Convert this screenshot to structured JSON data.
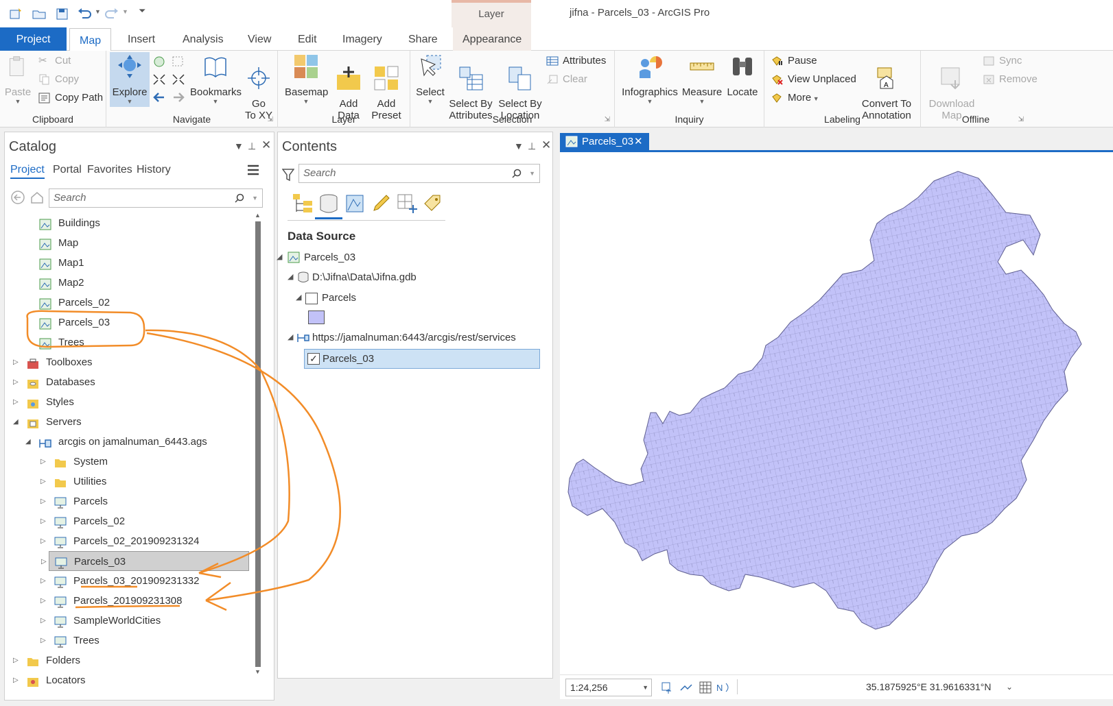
{
  "app": {
    "title": "jifna - Parcels_03 - ArcGIS Pro",
    "context_tab_group": "Layer"
  },
  "tabs": [
    "Project",
    "Map",
    "Insert",
    "Analysis",
    "View",
    "Edit",
    "Imagery",
    "Share",
    "Appearance"
  ],
  "active_tab": "Map",
  "ribbon": {
    "clipboard": {
      "label": "Clipboard",
      "paste": "Paste",
      "cut": "Cut",
      "copy": "Copy",
      "copy_path": "Copy Path"
    },
    "navigate": {
      "label": "Navigate",
      "explore": "Explore",
      "bookmarks": "Bookmarks",
      "goto": "Go\nTo XY"
    },
    "layer": {
      "label": "Layer",
      "basemap": "Basemap",
      "add_data": "Add\nData",
      "add_preset": "Add\nPreset"
    },
    "selection": {
      "label": "Selection",
      "select": "Select",
      "select_by_attributes": "Select By\nAttributes",
      "select_by_location": "Select By\nLocation",
      "attributes": "Attributes",
      "clear": "Clear"
    },
    "inquiry": {
      "label": "Inquiry",
      "infographics": "Infographics",
      "measure": "Measure",
      "locate": "Locate"
    },
    "labeling": {
      "label": "Labeling",
      "pause": "Pause",
      "view_unplaced": "View Unplaced",
      "more": "More",
      "convert": "Convert To\nAnnotation"
    },
    "offline": {
      "label": "Offline",
      "download": "Download\nMap",
      "sync": "Sync",
      "remove": "Remove"
    }
  },
  "catalog": {
    "title": "Catalog",
    "tabs": [
      "Project",
      "Portal",
      "Favorites",
      "History"
    ],
    "search_placeholder": "Search",
    "items": [
      {
        "label": "Buildings",
        "type": "map",
        "indent": 2,
        "expand": ""
      },
      {
        "label": "Map",
        "type": "map",
        "indent": 2,
        "expand": ""
      },
      {
        "label": "Map1",
        "type": "map",
        "indent": 2,
        "expand": ""
      },
      {
        "label": "Map2",
        "type": "map",
        "indent": 2,
        "expand": ""
      },
      {
        "label": "Parcels_02",
        "type": "map",
        "indent": 2,
        "expand": ""
      },
      {
        "label": "Parcels_03",
        "type": "map",
        "indent": 2,
        "expand": ""
      },
      {
        "label": "Trees",
        "type": "map",
        "indent": 2,
        "expand": ""
      },
      {
        "label": "Toolboxes",
        "type": "toolbox",
        "indent": 1,
        "expand": "collapsed"
      },
      {
        "label": "Databases",
        "type": "database",
        "indent": 1,
        "expand": "collapsed"
      },
      {
        "label": "Styles",
        "type": "style",
        "indent": 1,
        "expand": "collapsed"
      },
      {
        "label": "Servers",
        "type": "server",
        "indent": 1,
        "expand": "expanded"
      },
      {
        "label": "arcgis on jamalnuman_6443.ags",
        "type": "ags",
        "indent": 2,
        "expand": "expanded"
      },
      {
        "label": "System",
        "type": "folder",
        "indent": 3,
        "expand": "collapsed"
      },
      {
        "label": "Utilities",
        "type": "folder",
        "indent": 3,
        "expand": "collapsed"
      },
      {
        "label": "Parcels",
        "type": "service",
        "indent": 3,
        "expand": "collapsed"
      },
      {
        "label": "Parcels_02",
        "type": "service",
        "indent": 3,
        "expand": "collapsed"
      },
      {
        "label": "Parcels_02_201909231324",
        "type": "service",
        "indent": 3,
        "expand": "collapsed"
      },
      {
        "label": "Parcels_03",
        "type": "service",
        "indent": 3,
        "expand": "collapsed",
        "selected": true
      },
      {
        "label": "Parcels_03_201909231332",
        "type": "service",
        "indent": 3,
        "expand": "collapsed"
      },
      {
        "label": "Parcels_201909231308",
        "type": "service",
        "indent": 3,
        "expand": "collapsed"
      },
      {
        "label": "SampleWorldCities",
        "type": "service",
        "indent": 3,
        "expand": "collapsed"
      },
      {
        "label": "Trees",
        "type": "service",
        "indent": 3,
        "expand": "collapsed"
      },
      {
        "label": "Folders",
        "type": "folder",
        "indent": 1,
        "expand": "collapsed"
      },
      {
        "label": "Locators",
        "type": "locator",
        "indent": 1,
        "expand": "collapsed"
      }
    ]
  },
  "contents": {
    "title": "Contents",
    "search_placeholder": "Search",
    "section_title": "Data Source",
    "map_name": "Parcels_03",
    "gdb_path": "D:\\Jifna\\Data\\Jifna.gdb",
    "gdb_layer": "Parcels",
    "service_url": "https://jamalnuman:6443/arcgis/rest/services",
    "service_layer": "Parcels_03"
  },
  "map": {
    "tab_label": "Parcels_03",
    "scale": "1:24,256",
    "coordinates": "35.1875925°E 31.9616331°N",
    "fill_color": "#c2c2f8"
  }
}
